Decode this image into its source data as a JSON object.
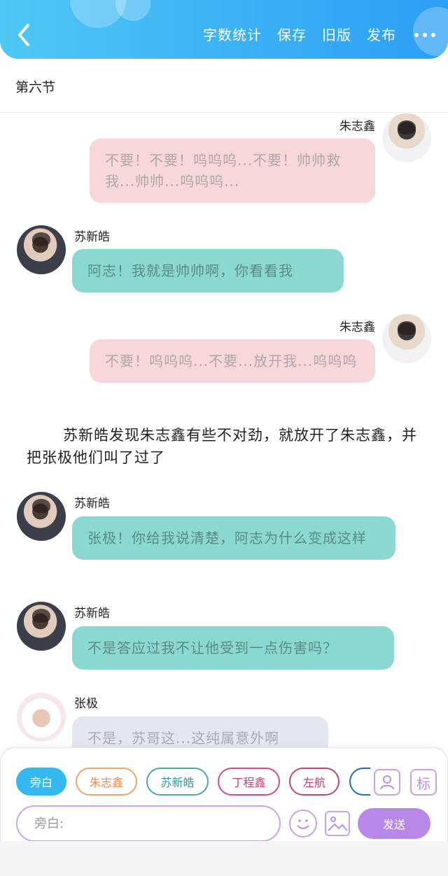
{
  "header": {
    "back_icon": "chevron-left-icon",
    "actions": [
      "字数统计",
      "保存",
      "旧版",
      "发布"
    ],
    "more_icon": "more-horizontal-icon",
    "colors": {
      "gradient_start": "#4fc8f5",
      "gradient_end": "#2d9ff5"
    }
  },
  "section": {
    "title": "第六节"
  },
  "messages": [
    {
      "speaker": "朱志鑫",
      "side": "right",
      "style": "pink",
      "text": "不要！不要！呜呜呜...不要！帅帅救我...帅帅...呜呜呜..."
    },
    {
      "speaker": "苏新皓",
      "side": "left",
      "style": "teal",
      "text": "阿志！我就是帅帅啊，你看看我"
    },
    {
      "speaker": "朱志鑫",
      "side": "right",
      "style": "pink",
      "text": "不要！呜呜呜...不要...放开我...呜呜呜"
    },
    {
      "speaker": "苏新皓",
      "side": "left",
      "style": "teal",
      "text": "张极！你给我说清楚，阿志为什么变成这样"
    },
    {
      "speaker": "苏新皓",
      "side": "left",
      "style": "teal",
      "text": "不是答应过我不让他受到一点伤害吗？"
    },
    {
      "speaker": "张极",
      "side": "left",
      "style": "gray",
      "text": "不是，苏哥这...这纯属意外啊"
    }
  ],
  "narration": "苏新皓发现朱志鑫有些不对劲，就放开了朱志鑫，并把张极他们叫了过了",
  "role_bar": {
    "roles": [
      "旁白",
      "朱志鑫",
      "苏新皓",
      "丁程鑫",
      "左航"
    ],
    "selected": "旁白",
    "contacts_icon": "person-card-icon",
    "mark_label": "标"
  },
  "composer": {
    "placeholder": "旁白:",
    "emoji_icon": "smiley-icon",
    "image_icon": "image-icon",
    "send_label": "发送",
    "colors": {
      "accent": "#b888e9",
      "selected_chip": "#35b7ef"
    }
  }
}
